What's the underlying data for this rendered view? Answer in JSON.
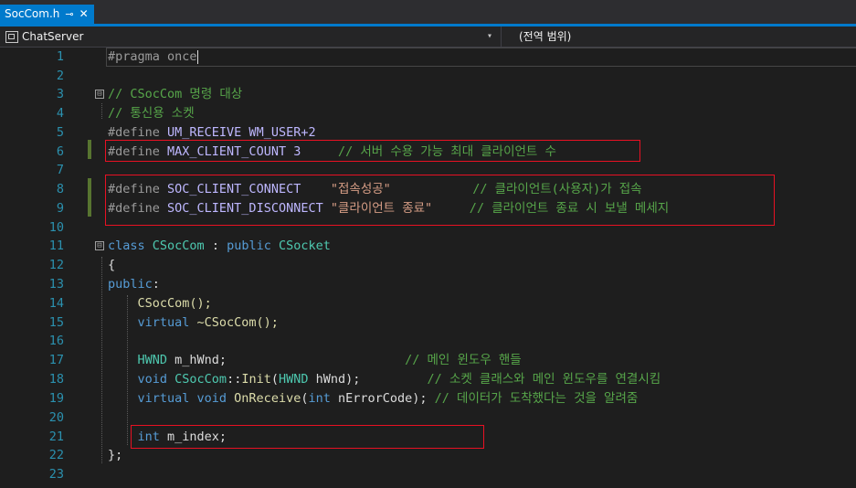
{
  "tab": {
    "title": "SocCom.h",
    "pin": "⊸",
    "close": "✕"
  },
  "navbar": {
    "project": "ChatServer",
    "dropdown_caret": "▾",
    "scope": "(전역 범위)"
  },
  "colors": {
    "accent": "#007acc",
    "highlight_box": "#e81123",
    "change_bar": "#577430"
  },
  "icons": {
    "project": "project-icon",
    "fold": "fold-toggle-icon"
  },
  "editor": {
    "line_numbers": [
      "1",
      "2",
      "3",
      "4",
      "5",
      "6",
      "7",
      "8",
      "9",
      "10",
      "11",
      "12",
      "13",
      "14",
      "15",
      "16",
      "17",
      "18",
      "19",
      "20",
      "21",
      "22",
      "23"
    ],
    "l1": {
      "a": "#pragma once"
    },
    "l3": {
      "fold": "⊟",
      "a": "// CSocCom 명령 대상"
    },
    "l4": {
      "a": "// 통신용 소켓"
    },
    "l5": {
      "a": "#define ",
      "b": "UM_RECEIVE WM_USER+2"
    },
    "l6": {
      "a": "#define ",
      "b": "MAX_CLIENT_COUNT 3",
      "c": "     // 서버 수용 가능 최대 클라이언트 수"
    },
    "l8": {
      "a": "#define ",
      "b": "SOC_CLIENT_CONNECT",
      "c": "    \"접속성공\"",
      "d": "           // 클라이언트(사용자)가 접속"
    },
    "l9": {
      "a": "#define ",
      "b": "SOC_CLIENT_DISCONNECT",
      "c": " \"클라이언트 종료\"",
      "d": "     // 클라이언트 종료 시 보낼 메세지"
    },
    "l11": {
      "fold": "⊟",
      "a": "class ",
      "b": "CSocCom",
      "c": " : ",
      "d": "public ",
      "e": "CSocket"
    },
    "l12": {
      "a": "{"
    },
    "l13": {
      "a": "public",
      "b": ":"
    },
    "l14": {
      "a": "    CSocCom();"
    },
    "l15": {
      "a": "    virtual",
      "b": " ~CSocCom();"
    },
    "l17": {
      "a": "    HWND",
      "b": " m_hWnd;",
      "c": "                        // 메인 윈도우 핸들"
    },
    "l18": {
      "a": "    void",
      "b": " CSocCom",
      "c": "::",
      "d": "Init",
      "e": "(",
      "f": "HWND",
      "g": " hWnd);",
      "h": "         // 소켓 클래스와 메인 윈도우를 연결시킴"
    },
    "l19": {
      "a": "    virtual void",
      "b": " OnReceive",
      "c": "(",
      "d": "int",
      "e": " nErrorCode); ",
      "f": "// 데이터가 도착했다는 것을 알려줌"
    },
    "l21": {
      "a": "    int",
      "b": " m_index;"
    },
    "l22": {
      "a": "};"
    }
  }
}
